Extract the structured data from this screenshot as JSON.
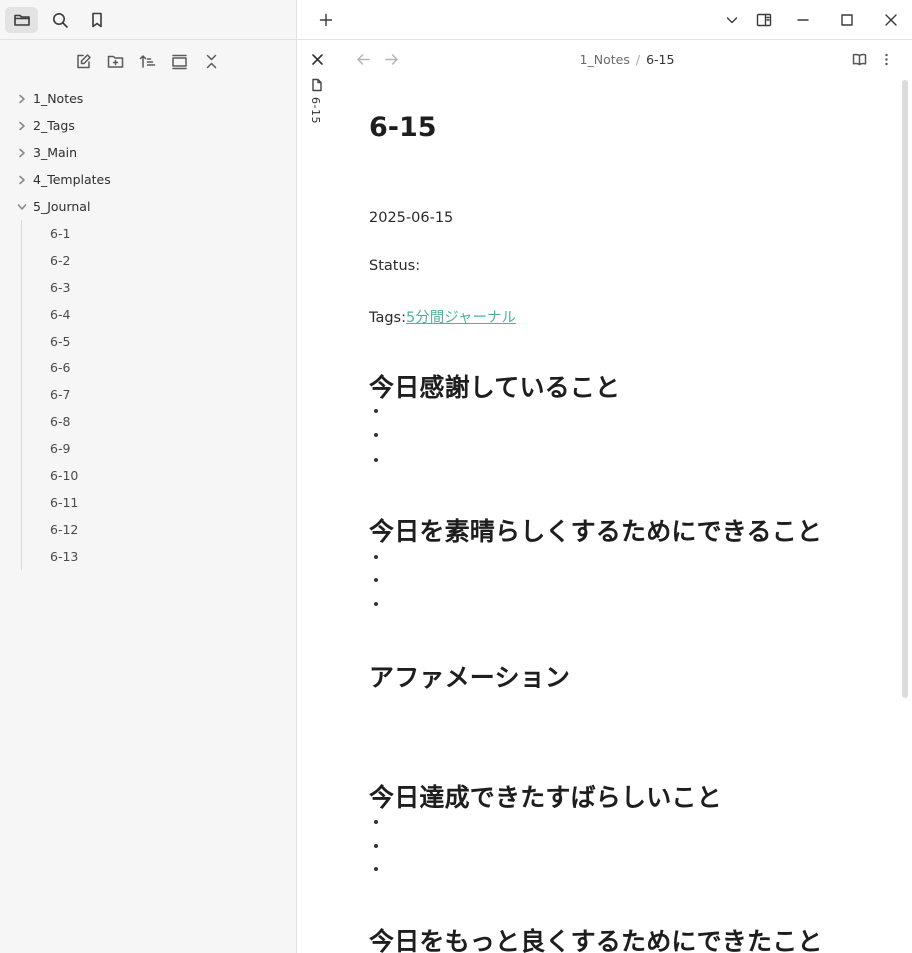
{
  "sidebar": {
    "tabs": [
      {
        "name": "files-tab",
        "icon": "folder-icon"
      },
      {
        "name": "search-tab",
        "icon": "search-icon"
      },
      {
        "name": "bookmarks-tab",
        "icon": "bookmark-icon"
      }
    ],
    "actions": [
      "new-note-icon",
      "new-folder-icon",
      "sort-icon",
      "auto-reveal-icon",
      "collapse-all-icon"
    ],
    "folders": [
      {
        "label": "1_Notes",
        "expanded": false
      },
      {
        "label": "2_Tags",
        "expanded": false
      },
      {
        "label": "3_Main",
        "expanded": false
      },
      {
        "label": "4_Templates",
        "expanded": false
      },
      {
        "label": "5_Journal",
        "expanded": true
      }
    ],
    "journal_files": [
      "6-1",
      "6-2",
      "6-3",
      "6-4",
      "6-5",
      "6-6",
      "6-7",
      "6-8",
      "6-9",
      "6-10",
      "6-11",
      "6-12",
      "6-13"
    ]
  },
  "tabbar": {
    "new_tab_icon": "plus-icon",
    "window_controls": [
      "chevron-down-icon",
      "sidebar-toggle-icon",
      "minimize-icon",
      "maximize-icon",
      "close-icon"
    ]
  },
  "view_header": {
    "breadcrumb": {
      "folder": "1_Notes",
      "separator": "/",
      "file": "6-15"
    },
    "side_tab_title": "6-15"
  },
  "note": {
    "title": "6-15",
    "date": "2025-06-15",
    "status_label": "Status:",
    "tags_label": "Tags:",
    "tag_link": "5分間ジャーナル",
    "sections": [
      {
        "heading": "今日感謝していること",
        "bullets": 3
      },
      {
        "heading": "今日を素晴らしくするためにできること",
        "bullets": 3
      },
      {
        "heading": "アファメーション",
        "bullets": 0
      },
      {
        "heading": "今日達成できたすばらしいこと",
        "bullets": 3
      },
      {
        "heading": "今日をもっと良くするためにできたこと",
        "bullets": 0
      }
    ]
  },
  "colors": {
    "accent_link": "#4fb39a",
    "window_topline": "#7ab648"
  }
}
